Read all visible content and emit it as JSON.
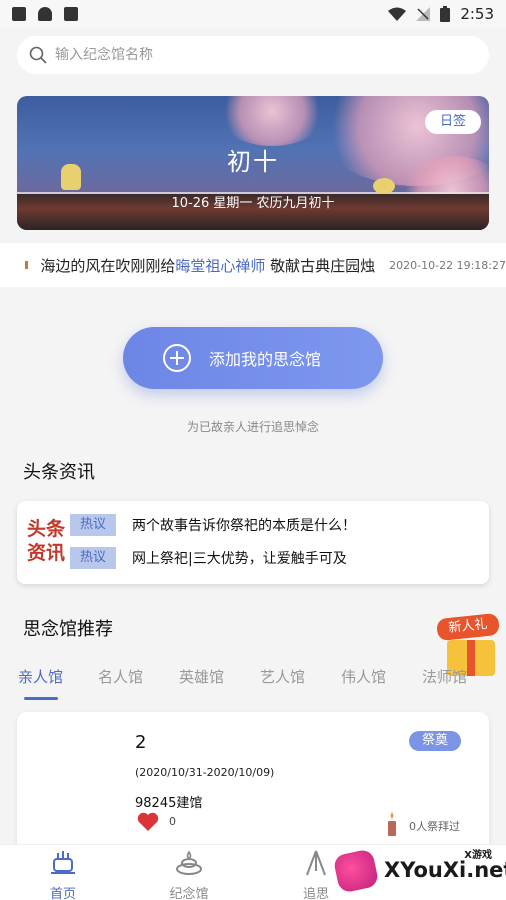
{
  "status_bar": {
    "time": "2:53"
  },
  "search": {
    "placeholder": "输入纪念馆名称"
  },
  "banner": {
    "lunar_big": "初十",
    "date_line": "10-26 星期一 农历九月初十",
    "sign_button": "日签"
  },
  "ticker": {
    "prefix": "海边的风在吹刚刚给",
    "highlight": "晦堂祖心禅师",
    "suffix": "敬献古典庄园烛",
    "time": "2020-10-22 19:18:27"
  },
  "add_memorial": {
    "button_label": "添加我的思念馆",
    "subtitle": "为已故亲人进行追思悼念"
  },
  "headlines": {
    "title": "头条资讯",
    "logo_line1": "头条",
    "logo_line2": "资讯",
    "items": [
      {
        "tag": "热议",
        "text": "两个故事告诉你祭祀的本质是什么！"
      },
      {
        "tag": "热议",
        "text": "网上祭祀|三大优势，让爱触手可及"
      }
    ]
  },
  "recommend": {
    "title": "思念馆推荐",
    "gift_label": "新人礼",
    "tabs": [
      "亲人馆",
      "名人馆",
      "英雄馆",
      "艺人馆",
      "伟人馆",
      "法师馆"
    ],
    "active_tab": "亲人馆"
  },
  "memorial_card": {
    "name": "2",
    "dates": "(2020/10/31-2020/10/09)",
    "id_line": "98245建馆",
    "badge": "祭奠",
    "likes": "0",
    "worship": "0人祭拜过"
  },
  "bottom_nav": [
    {
      "label": "首页",
      "icon": "home-incense-icon",
      "active": true
    },
    {
      "label": "纪念馆",
      "icon": "memorial-icon",
      "active": false
    },
    {
      "label": "追思",
      "icon": "pray-hands-icon",
      "active": false
    }
  ],
  "watermark": {
    "text": "XYouXi.net",
    "small": "X游戏"
  },
  "colors": {
    "accent": "#4a6bc6",
    "button": "#7c94e6",
    "heart": "#d9343a"
  }
}
